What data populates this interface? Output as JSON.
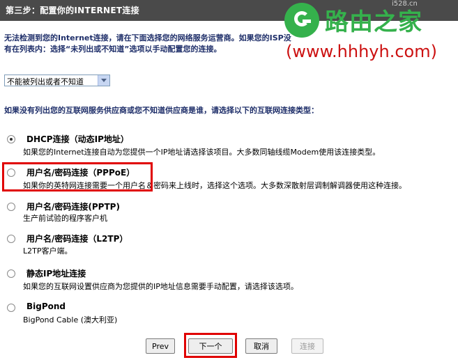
{
  "header": {
    "title": "第三步：配置你的INTERNET连接"
  },
  "watermark": {
    "brand": "路由之家",
    "url": "(www.hhhyh.com)",
    "small": "i528.cn"
  },
  "intro": {
    "text": "无法检测到您的Internet连接，请在下面选择您的网络服务运营商。如果您的ISP没有在列表内：选择“未列出或不知道”选项以手动配置您的连接。",
    "faded": "如果您的ISP没有在列表内：选择“未列出"
  },
  "isp_select": {
    "value": "不能被列出或者不知道"
  },
  "prompt": "如果没有列出您的互联网服务供应商或您不知道供应商是谁，请选择以下的互联网连接类型：",
  "options": [
    {
      "title": "DHCP连接（动态IP地址）",
      "desc": "如果您的Internet连接自动为您提供一个IP地址请选择该项目。大多数同轴线缆Modem使用该连接类型。",
      "checked": true
    },
    {
      "title": "用户名/密码连接（PPPoE）",
      "desc": "如果你的英特网连接需要一个用户名＆密码来上线时，选择这个选项。大多数深散射层调制解调器使用这种连接。",
      "checked": false
    },
    {
      "title": "用户名/密码连接(PPTP)",
      "desc": "生产前试验的程序客户机",
      "checked": false
    },
    {
      "title": "用户名/密码连接（L2TP）",
      "desc": "L2TP客户端。",
      "checked": false
    },
    {
      "title": "静态IP地址连接",
      "desc": "如果您的互联网设置供应商为您提供的IP地址信息需要手动配置，请选择该选项。",
      "checked": false
    },
    {
      "title": "BigPond",
      "desc": "BigPond Cable (澳大利亚)",
      "checked": false
    }
  ],
  "buttons": {
    "prev": "Prev",
    "next": "下一个",
    "cancel": "取消",
    "connect": "连接"
  },
  "colors": {
    "header_bg": "#4a4a4a",
    "highlight": "#e00000",
    "logo_green": "#35b14c",
    "logo_red": "#cc1111",
    "intro_text": "#1f2f6a"
  }
}
